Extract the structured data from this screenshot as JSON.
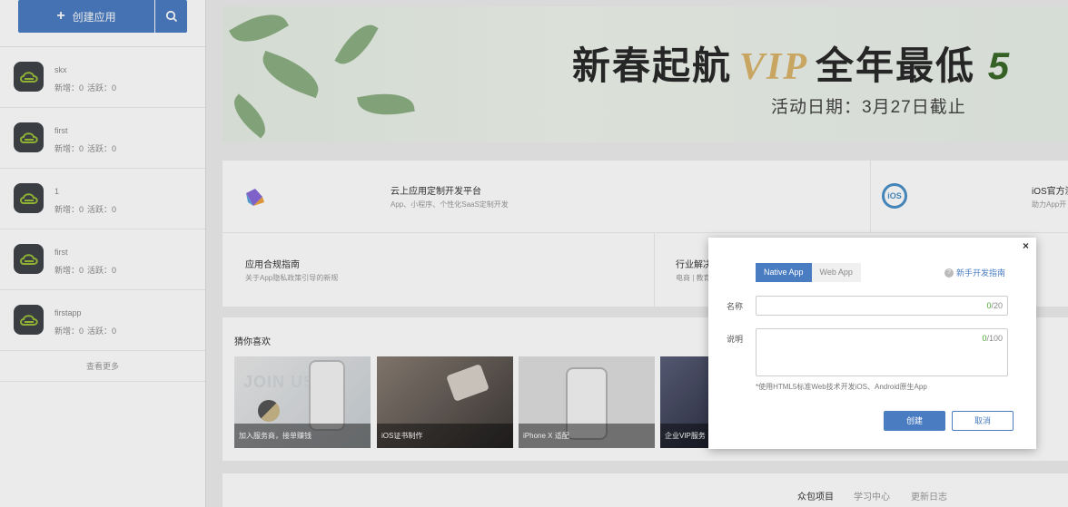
{
  "sidebar": {
    "create_label": "创建应用",
    "more_label": "查看更多",
    "apps": [
      {
        "name": "skx",
        "new_label": "新增：0",
        "active_label": "活跃：0"
      },
      {
        "name": "first",
        "new_label": "新增：0",
        "active_label": "活跃：0"
      },
      {
        "name": "1",
        "new_label": "新增：0",
        "active_label": "活跃：0"
      },
      {
        "name": "first",
        "new_label": "新增：0",
        "active_label": "活跃：0"
      },
      {
        "name": "firstapp",
        "new_label": "新增：0",
        "active_label": "活跃：0"
      }
    ]
  },
  "banner": {
    "title_pre": "新春起航",
    "title_vip": "VIP",
    "title_post": "全年最低",
    "title_num": "5",
    "subtitle": "活动日期：3月27日截止"
  },
  "services": {
    "cloud": {
      "title": "云上应用定制开发平台",
      "sub": "App、小程序、个性化SaaS定制开发"
    },
    "ios": {
      "badge": "iOS",
      "title": "iOS官方测",
      "sub": "助力App开"
    },
    "compliance": {
      "title": "应用合规指南",
      "sub": "关于App隐私政策引导的新规"
    },
    "industry": {
      "title": "行业解决",
      "sub": "电商 | 教育"
    }
  },
  "recommend": {
    "title": "猜你喜欢",
    "cards": [
      {
        "label": "加入服务商，接单赚钱",
        "overlay": "JOIN US"
      },
      {
        "label": "iOS证书制作"
      },
      {
        "label": "iPhone X 适配"
      },
      {
        "label": "企业VIP服务"
      }
    ]
  },
  "bottom_tabs": [
    "众包项目",
    "学习中心",
    "更新日志"
  ],
  "modal": {
    "close": "×",
    "tabs": [
      "Native App",
      "Web App"
    ],
    "guide": "新手开发指南",
    "name_label": "名称",
    "name_count": "0",
    "name_max": "/20",
    "desc_label": "说明",
    "desc_count": "0",
    "desc_max": "/100",
    "hint": "*使用HTML5标准Web技术开发iOS、Android原生App",
    "create_label": "创建",
    "cancel_label": "取消"
  },
  "colors": {
    "accent": "#4a7cc2",
    "counter": "#4aa52e",
    "icon_bg": "#3f4348",
    "icon_fg": "#9cc23a"
  }
}
